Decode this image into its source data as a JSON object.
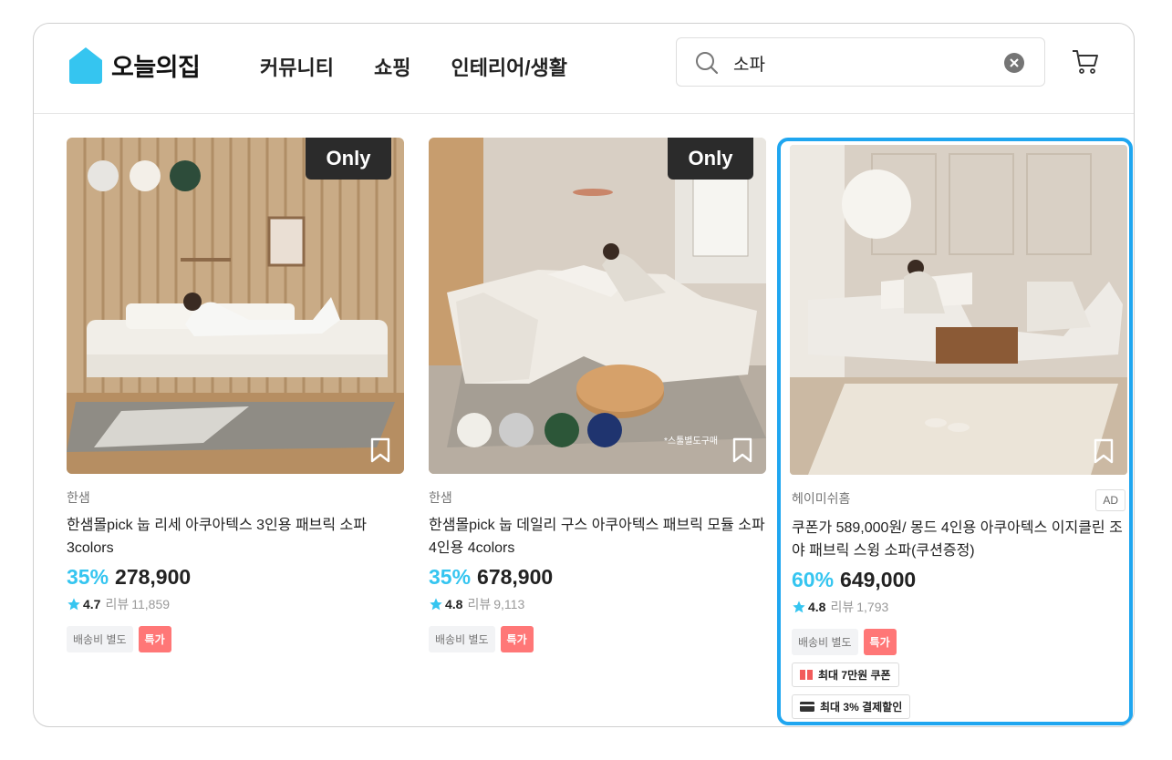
{
  "header": {
    "logo_text": "오늘의집",
    "nav": [
      "커뮤니티",
      "쇼핑",
      "인테리어/생활"
    ],
    "search_value": "소파"
  },
  "products": [
    {
      "badge": "Only",
      "brand": "한샘",
      "title": "한샘몰pick 눕 리세 아쿠아텍스 3인용 패브릭 소파 3colors",
      "discount": "35%",
      "price": "278,900",
      "rating": "4.7",
      "review_label": "리뷰",
      "review_count": "11,859",
      "badges": [
        "배송비 별도",
        "특가"
      ]
    },
    {
      "badge": "Only",
      "brand": "한샘",
      "title": "한샘몰pick 눕 데일리 구스 아쿠아텍스 패브릭 모듈 소파 4인용 4colors",
      "discount": "35%",
      "price": "678,900",
      "rating": "4.8",
      "review_label": "리뷰",
      "review_count": "9,113",
      "badges": [
        "배송비 별도",
        "특가"
      ],
      "image_caption": "*스툴별도구매"
    },
    {
      "brand": "헤이미쉬홈",
      "ad_label": "AD",
      "title": "쿠폰가 589,000원/ 몽드 4인용 아쿠아텍스 이지클린 조야 패브릭 스윙 소파(쿠션증정)",
      "discount": "60%",
      "price": "649,000",
      "rating": "4.8",
      "review_label": "리뷰",
      "review_count": "1,793",
      "badges": [
        "배송비 별도",
        "특가"
      ],
      "coupons": [
        "최대 7만원 쿠폰",
        "최대 3% 결제할인"
      ]
    }
  ],
  "colors": {
    "accent": "#35c5f0",
    "ad_border": "#1fa6f0",
    "sale_badge": "#ff7777"
  }
}
